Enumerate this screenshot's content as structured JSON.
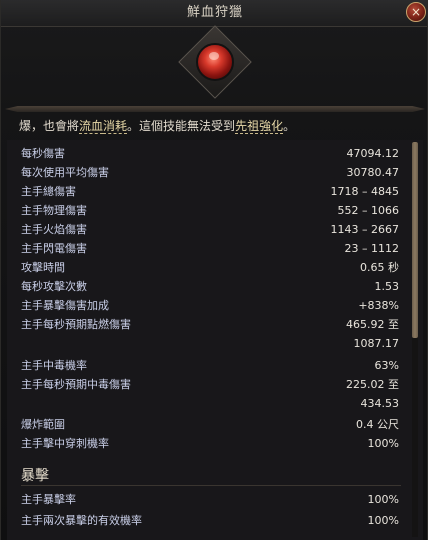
{
  "window": {
    "title": "鮮血狩獵",
    "close_symbol": "×"
  },
  "description": {
    "prefix": "爆，也會將",
    "key1": "流血",
    "mid1": "",
    "key2": "消耗",
    "mid2": "。這個技能無法受到",
    "key3": "先祖強化",
    "suffix": "。"
  },
  "stats": [
    {
      "label": "每秒傷害",
      "value": "47094.12"
    },
    {
      "label": "每次使用平均傷害",
      "value": "30780.47"
    },
    {
      "label": "主手總傷害",
      "value": "1718 – 4845"
    },
    {
      "label": "主手物理傷害",
      "value": "552 – 1066"
    },
    {
      "label": "主手火焰傷害",
      "value": "1143 – 2667"
    },
    {
      "label": "主手閃電傷害",
      "value": "23 – 1112"
    },
    {
      "label": "攻擊時間",
      "value": "0.65 秒"
    },
    {
      "label": "每秒攻擊次數",
      "value": "1.53"
    },
    {
      "label": "主手暴擊傷害加成",
      "value": "+838%"
    },
    {
      "label": "主手每秒預期點燃傷害",
      "value": "465.92 至",
      "value2": "1087.17"
    },
    {
      "label": "主手中毒機率",
      "value": "63%"
    },
    {
      "label": "主手每秒預期中毒傷害",
      "value": "225.02 至",
      "value2": "434.53"
    },
    {
      "label": "爆炸範圍",
      "value": "0.4 公尺"
    },
    {
      "label": "主手擊中穿刺機率",
      "value": "100%"
    }
  ],
  "crit_section": {
    "title": "暴擊",
    "stats": [
      {
        "label": "主手暴擊率",
        "value": "100%"
      },
      {
        "label": "主手兩次暴擊的有效機率",
        "value": "100%"
      }
    ]
  }
}
